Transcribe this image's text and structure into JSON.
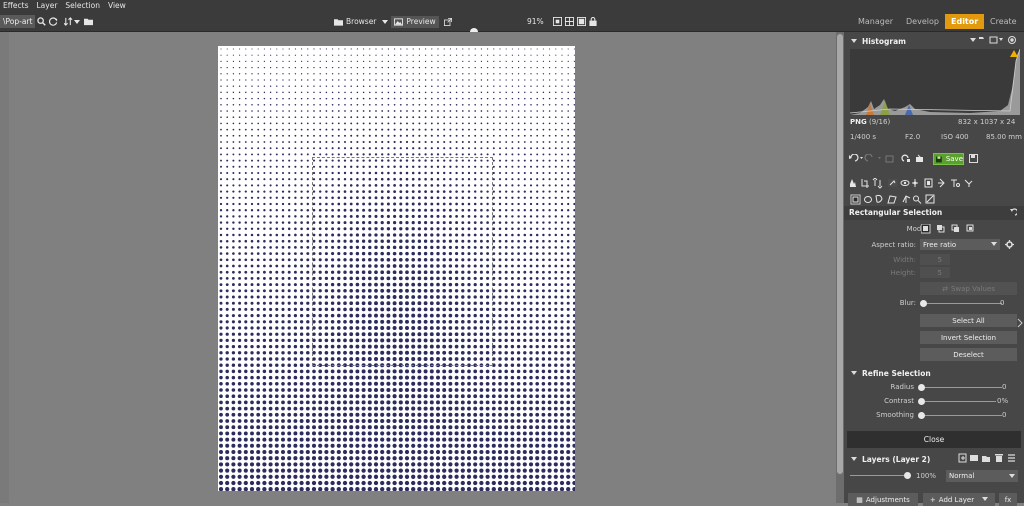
{
  "menu": [
    "Effects",
    "Layer",
    "Selection",
    "View"
  ],
  "toolbar": {
    "path": "\\Pop-art",
    "browser_label": "Browser",
    "preview_label": "Preview",
    "zoom": "91%"
  },
  "modes": [
    "Manager",
    "Develop",
    "Editor",
    "Create"
  ],
  "active_mode": "Editor",
  "histogram": {
    "title": "Histogram",
    "format": "PNG",
    "index": "(9/16)",
    "dimensions": "832 x 1037 x 24",
    "shutter": "1/400 s",
    "aperture": "F2.0",
    "iso": "ISO 400",
    "focal": "85.00 mm"
  },
  "save_label": "Save",
  "rect_selection": {
    "title": "Rectangular Selection",
    "mode_label": "Mode:",
    "aspect_label": "Aspect ratio:",
    "aspect_value": "Free ratio",
    "width_label": "Width:",
    "width_value": "5",
    "height_label": "Height:",
    "height_value": "5",
    "swap_label": "Swap Values",
    "blur_label": "Blur:",
    "blur_value": "0",
    "select_all": "Select All",
    "invert_selection": "Invert Selection",
    "deselect": "Deselect"
  },
  "refine": {
    "title": "Refine Selection",
    "radius_label": "Radius",
    "radius_value": "0",
    "contrast_label": "Contrast",
    "contrast_value": "0%",
    "smoothing_label": "Smoothing",
    "smoothing_value": "0"
  },
  "close_label": "Close",
  "layers": {
    "title": "Layers (Layer 2)",
    "opacity": "100%",
    "blend": "Normal",
    "adjustments": "Adjustments",
    "add_layer": "Add Layer",
    "fx": "fx"
  },
  "colors": {
    "accent": "#e19a0d",
    "save_green": "#5aa02c",
    "dot": "#2c2c5e"
  }
}
